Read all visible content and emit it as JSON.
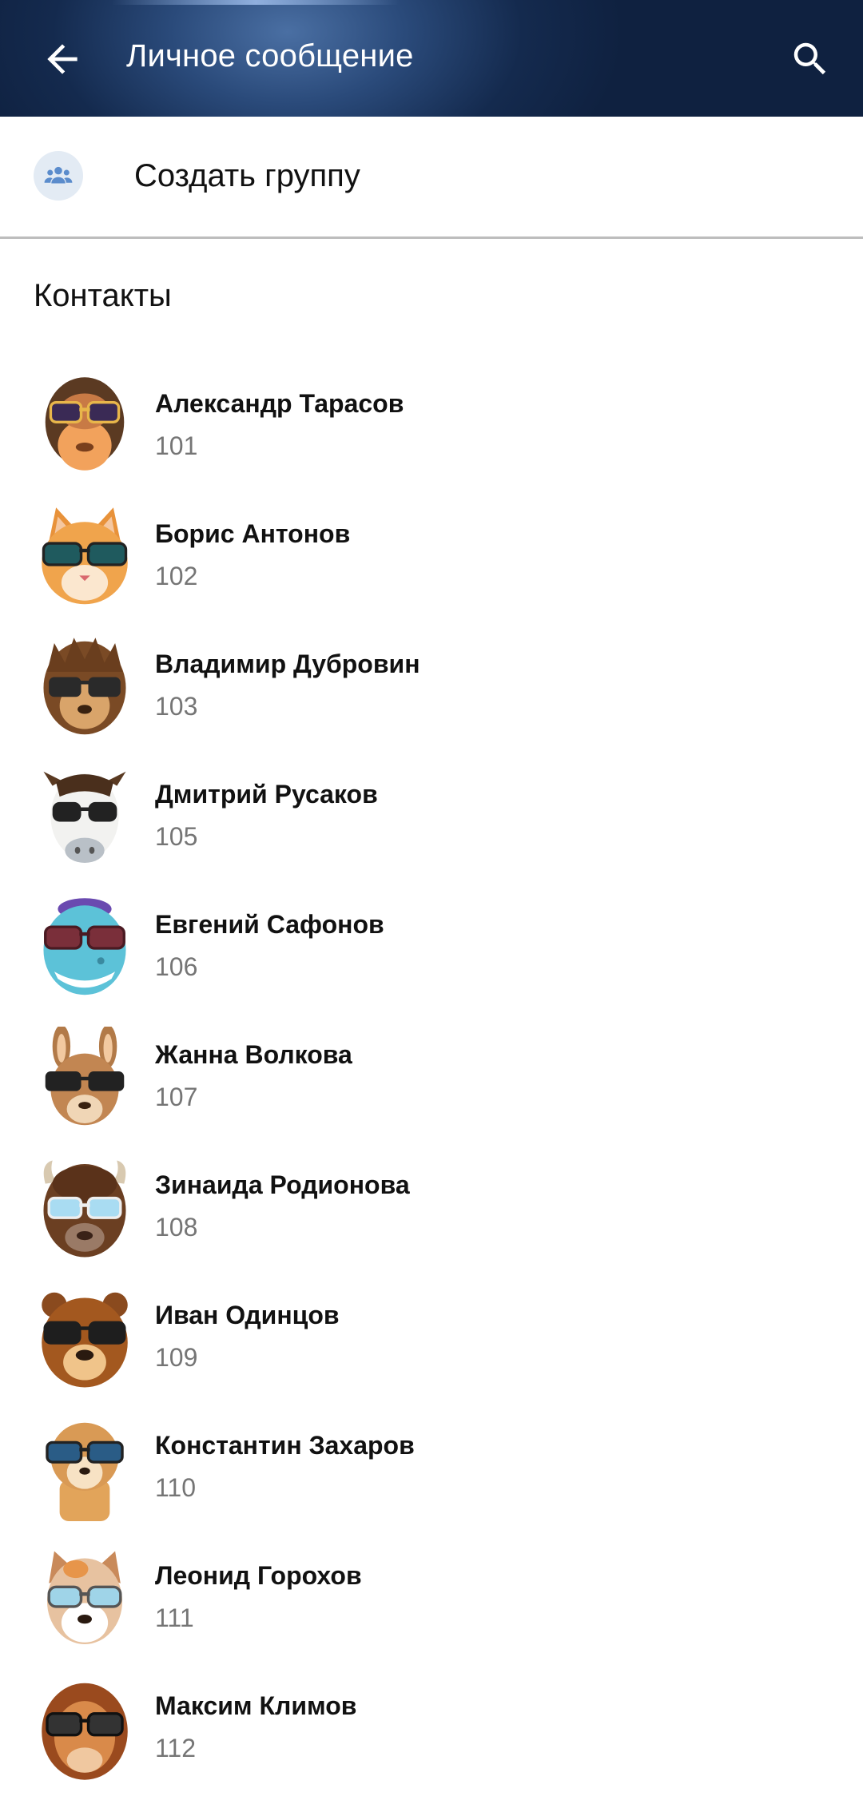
{
  "appbar": {
    "title": "Личное сообщение",
    "back_icon": "arrow-back-icon",
    "search_icon": "search-icon"
  },
  "create_group": {
    "label": "Создать группу",
    "icon": "group-icon"
  },
  "section": {
    "title": "Контакты"
  },
  "contacts": [
    {
      "name": "Александр Тарасов",
      "number": "101",
      "avatar": "monkey-avatar-icon"
    },
    {
      "name": "Борис Антонов",
      "number": "102",
      "avatar": "cat-avatar-icon"
    },
    {
      "name": "Владимир Дубровин",
      "number": "103",
      "avatar": "hedgehog-avatar-icon"
    },
    {
      "name": "Дмитрий Русаков",
      "number": "105",
      "avatar": "cow-avatar-icon"
    },
    {
      "name": "Евгений Сафонов",
      "number": "106",
      "avatar": "dinosaur-avatar-icon"
    },
    {
      "name": "Жанна Волкова",
      "number": "107",
      "avatar": "kangaroo-avatar-icon"
    },
    {
      "name": "Зинаида Родионова",
      "number": "108",
      "avatar": "bison-avatar-icon"
    },
    {
      "name": "Иван Одинцов",
      "number": "109",
      "avatar": "bear-avatar-icon"
    },
    {
      "name": "Константин Захаров",
      "number": "110",
      "avatar": "meerkat-avatar-icon"
    },
    {
      "name": "Леонид Горохов",
      "number": "111",
      "avatar": "dog-avatar-icon"
    },
    {
      "name": "Максим Климов",
      "number": "112",
      "avatar": "lion-avatar-icon"
    }
  ],
  "colors": {
    "appbar_dark": "#0f2140",
    "appbar_light": "#4a6fa3",
    "group_icon": "#5b8ccc",
    "group_icon_bg": "#e3ebf4",
    "divider": "#bdbdbd",
    "number_text": "#757575"
  }
}
